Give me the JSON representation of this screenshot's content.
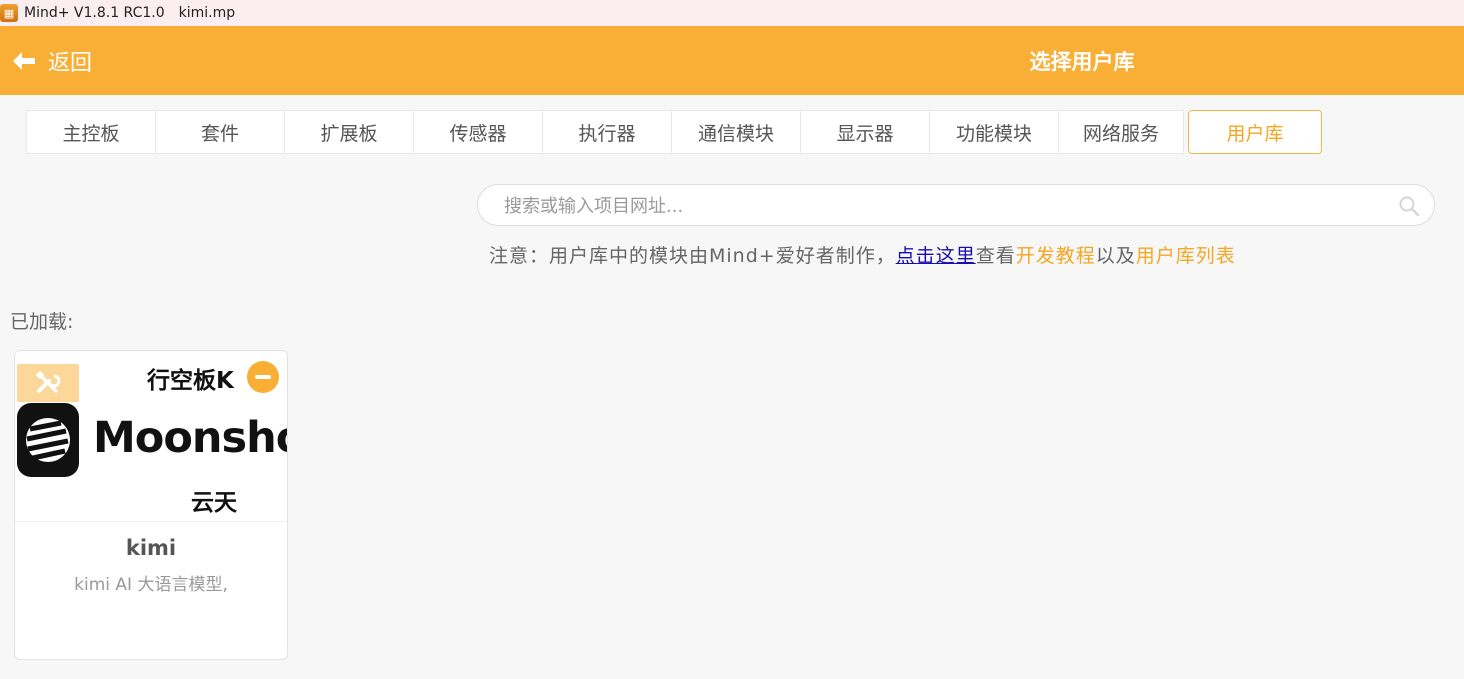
{
  "window": {
    "app_title": "Mind+ V1.8.1 RC1.0",
    "file_name": "kimi.mp"
  },
  "header": {
    "back_label": "返回",
    "title": "选择用户库"
  },
  "tabs": [
    {
      "label": "主控板",
      "active": false
    },
    {
      "label": "套件",
      "active": false
    },
    {
      "label": "扩展板",
      "active": false
    },
    {
      "label": "传感器",
      "active": false
    },
    {
      "label": "执行器",
      "active": false
    },
    {
      "label": "通信模块",
      "active": false
    },
    {
      "label": "显示器",
      "active": false
    },
    {
      "label": "功能模块",
      "active": false
    },
    {
      "label": "网络服务",
      "active": false
    },
    {
      "label": "用户库",
      "active": true
    }
  ],
  "search": {
    "placeholder": "搜索或输入项目网址...",
    "value": ""
  },
  "notice": {
    "prefix": "注意：用户库中的模块由Mind+爱好者制作，",
    "link_text": "点击这里",
    "middle": "查看",
    "tutorial_text": "开发教程",
    "conj": "以及",
    "list_text": "用户库列表"
  },
  "loaded": {
    "label": "已加载:",
    "items": [
      {
        "board_label": "行空板K",
        "brand": "Moonshot",
        "author": "云天",
        "name": "kimi",
        "description": "kimi AI 大语言模型,"
      }
    ]
  },
  "colors": {
    "accent": "#f9ae35",
    "accent_text": "#f5a623",
    "link": "#1a0dab"
  }
}
